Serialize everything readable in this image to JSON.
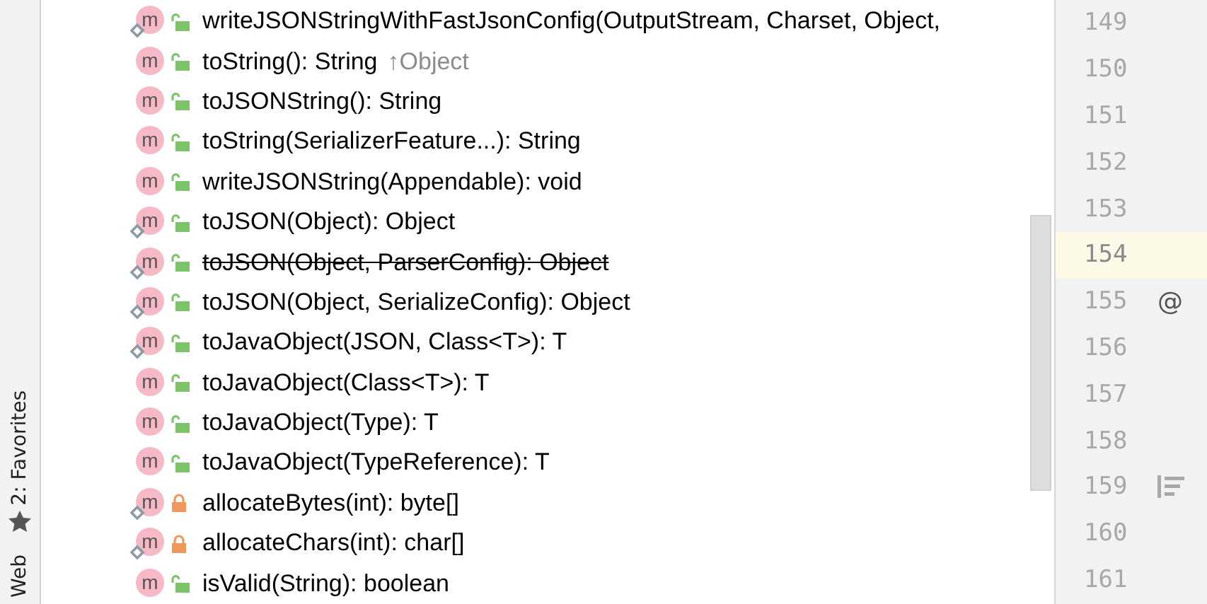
{
  "tool_strip": {
    "favorites_label": "2: Favorites",
    "web_label": "Web"
  },
  "members": [
    {
      "kind": "method",
      "icon": "m",
      "signature": "writeJSONStringWithFastJsonConfig(OutputStream, Charset, Object,",
      "locked": false,
      "override": true,
      "deprecated": false
    },
    {
      "kind": "method",
      "icon": "m",
      "signature": "toString(): String",
      "inherited": "↑Object",
      "locked": false,
      "override": false,
      "deprecated": false
    },
    {
      "kind": "method",
      "icon": "m",
      "signature": "toJSONString(): String",
      "locked": false,
      "override": false,
      "deprecated": false
    },
    {
      "kind": "method",
      "icon": "m",
      "signature": "toString(SerializerFeature...): String",
      "locked": false,
      "override": false,
      "deprecated": false
    },
    {
      "kind": "method",
      "icon": "m",
      "signature": "writeJSONString(Appendable): void",
      "locked": false,
      "override": false,
      "deprecated": false
    },
    {
      "kind": "method",
      "icon": "m",
      "signature": "toJSON(Object): Object",
      "locked": false,
      "override": true,
      "deprecated": false
    },
    {
      "kind": "method",
      "icon": "m",
      "signature": "toJSON(Object, ParserConfig): Object",
      "locked": false,
      "override": true,
      "deprecated": true
    },
    {
      "kind": "method",
      "icon": "m",
      "signature": "toJSON(Object, SerializeConfig): Object",
      "locked": false,
      "override": true,
      "deprecated": false
    },
    {
      "kind": "method",
      "icon": "m",
      "signature": "toJavaObject(JSON, Class<T>): T",
      "locked": false,
      "override": true,
      "deprecated": false
    },
    {
      "kind": "method",
      "icon": "m",
      "signature": "toJavaObject(Class<T>): T",
      "locked": false,
      "override": false,
      "deprecated": false
    },
    {
      "kind": "method",
      "icon": "m",
      "signature": "toJavaObject(Type): T",
      "locked": false,
      "override": false,
      "deprecated": false
    },
    {
      "kind": "method",
      "icon": "m",
      "signature": "toJavaObject(TypeReference): T",
      "locked": false,
      "override": false,
      "deprecated": false
    },
    {
      "kind": "method",
      "icon": "m",
      "signature": "allocateBytes(int): byte[]",
      "locked": true,
      "override": true,
      "deprecated": false
    },
    {
      "kind": "method",
      "icon": "m",
      "signature": "allocateChars(int): char[]",
      "locked": true,
      "override": true,
      "deprecated": false
    },
    {
      "kind": "method",
      "icon": "m",
      "signature": "isValid(String): boolean",
      "locked": false,
      "override": false,
      "deprecated": false
    }
  ],
  "gutter": [
    {
      "line": "149",
      "current": false
    },
    {
      "line": "150",
      "current": false
    },
    {
      "line": "151",
      "current": false
    },
    {
      "line": "152",
      "current": false
    },
    {
      "line": "153",
      "current": false
    },
    {
      "line": "154",
      "current": true
    },
    {
      "line": "155",
      "current": false,
      "marker": "@",
      "kind": "annotation"
    },
    {
      "line": "156",
      "current": false
    },
    {
      "line": "157",
      "current": false
    },
    {
      "line": "158",
      "current": false
    },
    {
      "line": "159",
      "current": false,
      "kind": "format"
    },
    {
      "line": "160",
      "current": false
    },
    {
      "line": "161",
      "current": false
    }
  ]
}
